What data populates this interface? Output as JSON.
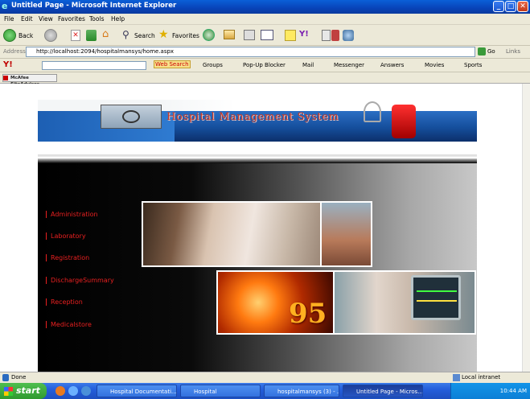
{
  "window": {
    "title": "Untitled Page - Microsoft Internet Explorer",
    "controls": {
      "minimize": "_",
      "maximize": "□",
      "close": "✕"
    }
  },
  "menu": [
    "File",
    "Edit",
    "View",
    "Favorites",
    "Tools",
    "Help"
  ],
  "toolbar": {
    "back_label": "Back",
    "search_label": "Search",
    "favorites_label": "Favorites"
  },
  "address": {
    "label": "Address",
    "url": "http://localhost:2094/hospitalmansys/home.aspx",
    "go_label": "Go",
    "links_label": "Links"
  },
  "yahoo_bar": {
    "logo": "Y!",
    "web_search": "Web Search",
    "groups": "Groups",
    "popup": "Pop-Up Blocker",
    "mail": "Mail",
    "messenger": "Messenger",
    "answers": "Answers",
    "movies": "Movies",
    "sports": "Sports"
  },
  "mcafee_bar": {
    "label": "McAfee SiteAdvisor"
  },
  "page": {
    "banner_title": "Hospital Management System",
    "nav": [
      "Administration",
      "Laboratory",
      "Registration",
      "DischargeSummary",
      "Reception",
      "Medicalstore"
    ],
    "gauge_number": "95"
  },
  "status": {
    "text": "Done",
    "zone": "Local intranet"
  },
  "taskbar": {
    "start": "start",
    "tasks": [
      "Hospital Documentati...",
      "Hospital",
      "hospitalmansys (3) - ...",
      "Untitled Page - Micros..."
    ],
    "clock": "10:44 AM"
  },
  "colors": {
    "accent_red": "#e82020",
    "title_blue": "#0a5fd8",
    "banner_blue": "#154e9b"
  }
}
